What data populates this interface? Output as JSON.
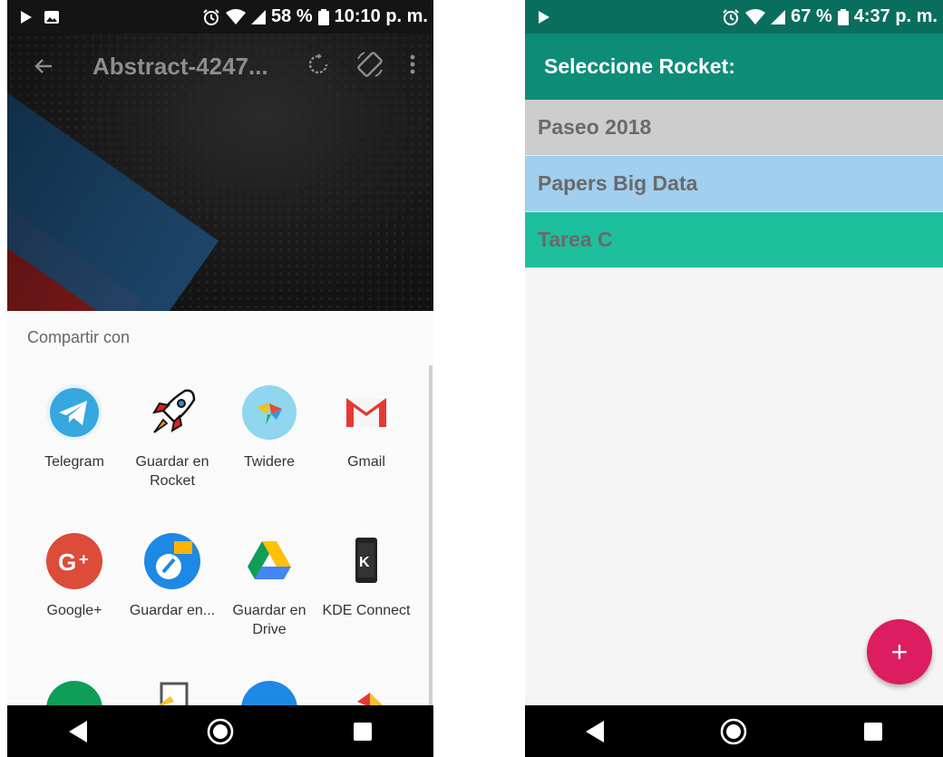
{
  "left_phone": {
    "status": {
      "battery": "58 %",
      "time": "10:10 p. m."
    },
    "viewer": {
      "title": "Abstract-4247..."
    },
    "share": {
      "header": "Compartir con",
      "apps": [
        {
          "label": "Telegram",
          "icon": "telegram-icon"
        },
        {
          "label": "Guardar en Rocket",
          "icon": "rocket-icon"
        },
        {
          "label": "Twidere",
          "icon": "twidere-icon"
        },
        {
          "label": "Gmail",
          "icon": "gmail-icon"
        },
        {
          "label": "Google+",
          "icon": "google-plus-icon"
        },
        {
          "label": "Guardar en...",
          "icon": "save-to-icon"
        },
        {
          "label": "Guardar en Drive",
          "icon": "drive-icon"
        },
        {
          "label": "KDE Connect",
          "icon": "kde-connect-icon"
        }
      ]
    }
  },
  "right_phone": {
    "status": {
      "battery": "67 %",
      "time": "4:37 p. m."
    },
    "app_bar": {
      "title": "Seleccione Rocket:"
    },
    "rockets": [
      {
        "name": "Paseo 2018",
        "color": "#cdcdcd"
      },
      {
        "name": "Papers Big Data",
        "color": "#a0cfef"
      },
      {
        "name": "Tarea C",
        "color": "#1dbf9c"
      }
    ],
    "fab": {
      "label": "+",
      "color": "#dc1d5f"
    }
  }
}
